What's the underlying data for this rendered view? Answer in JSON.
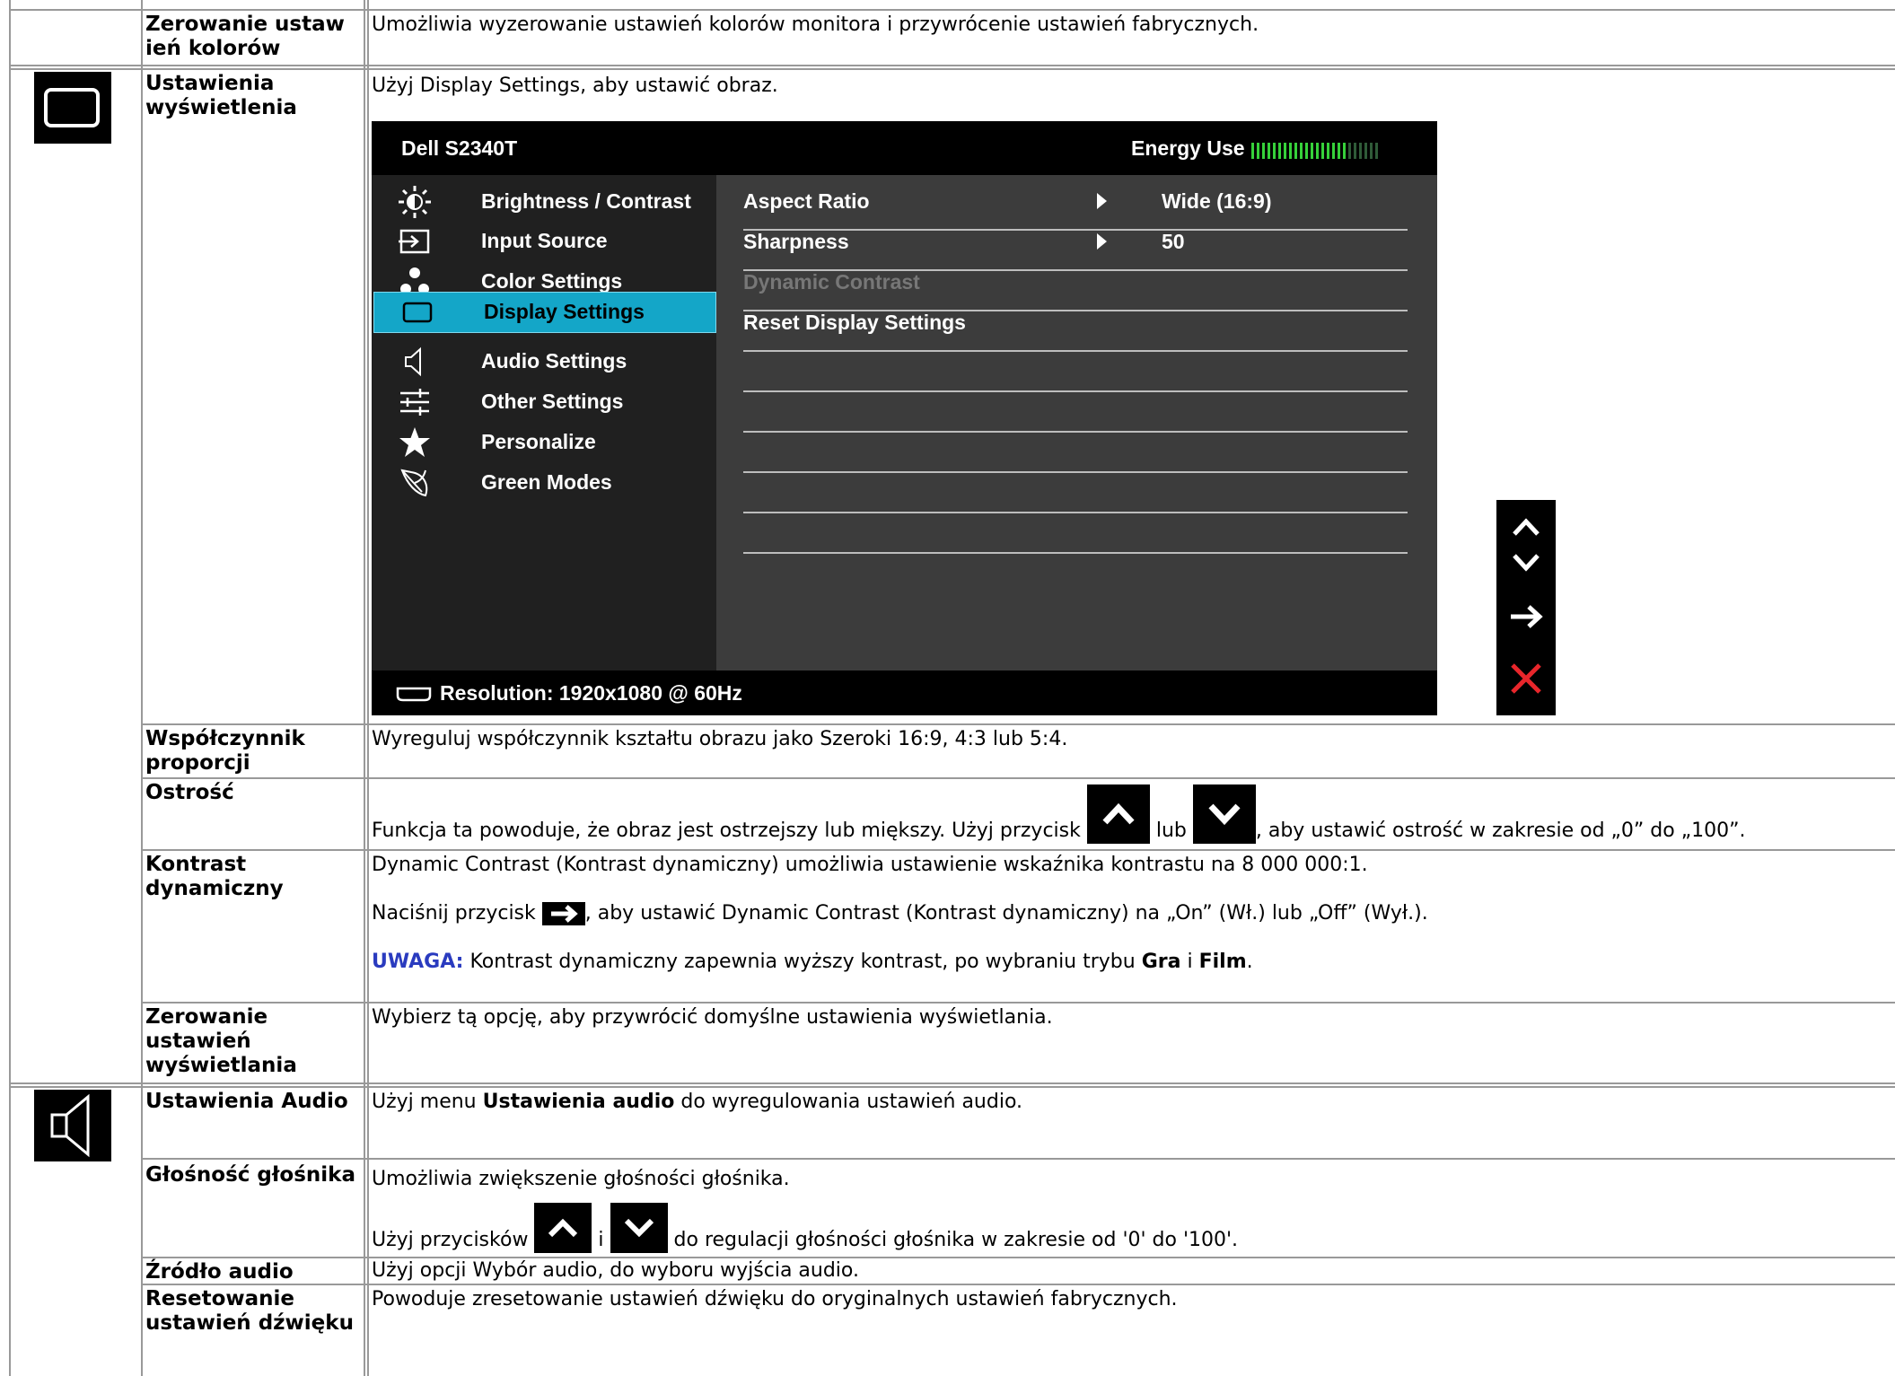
{
  "rows": [
    {
      "label": "Zerowanie ustaw\nień kolorów",
      "desc": "Umożliwia wyzerowanie ustawień kolorów monitora i przywrócenie ustawień fabrycznych."
    },
    {
      "label": "Ustawienia wyświetlenia",
      "desc": "Użyj Display Settings, aby ustawić obraz."
    },
    {
      "label": "Współczynnik proporcji",
      "desc": "Wyreguluj współczynnik kształtu obrazu jako Szeroki 16:9, 4:3 lub 5:4."
    },
    {
      "label": "Ostrość",
      "desc_a": "Funkcja ta powoduje, że obraz jest ostrzejszy lub miększy. Użyj przycisk ",
      "desc_b": " lub ",
      "desc_c": ", aby ustawić ostrość w zakresie od „0” do „100”."
    },
    {
      "label": "Kontrast dynamiczny",
      "desc1": "Dynamic Contrast (Kontrast dynamiczny) umożliwia ustawienie wskaźnika kontrastu na 8 000 000:1.",
      "desc2_a": "Naciśnij przycisk ",
      "desc2_b": ", aby ustawić Dynamic Contrast (Kontrast dynamiczny) na „On” (Wł.) lub „Off” (Wył.).",
      "note_key": "UWAGA:",
      "note_a": " Kontrast dynamiczny zapewnia wyższy kontrast, po wybraniu trybu ",
      "note_b": "Gra",
      "note_c": " i ",
      "note_d": "Film",
      "note_e": "."
    },
    {
      "label": "Zerowanie ustawień wyświetlania",
      "desc": "Wybierz tą opcję, aby przywrócić domyślne ustawienia wyświetlania."
    },
    {
      "label": "Ustawienia Audio",
      "desc_a": "Użyj menu ",
      "desc_b": "Ustawienia audio",
      "desc_c": " do wyregulowania ustawień audio."
    },
    {
      "label": "Głośność głośnika",
      "desc1": "Umożliwia zwiększenie głośności głośnika.",
      "desc2_a": "Użyj przycisków ",
      "desc2_b": " i ",
      "desc2_c": " do regulacji głośności głośnika w zakresie od '0' do '100'."
    },
    {
      "label": "Źródło audio",
      "desc": "Użyj opcji Wybór audio, do wyboru wyjścia audio."
    },
    {
      "label": "Resetowanie ustawień dźwięku",
      "desc": "Powoduje zresetowanie ustawień dźwięku do oryginalnych ustawień fabrycznych."
    }
  ],
  "osd": {
    "model": "Dell S2340T",
    "energy_label": "Energy Use",
    "energy_level": 0.75,
    "menu": [
      {
        "label": "Brightness / Contrast",
        "icon": "brightness-icon"
      },
      {
        "label": "Input Source",
        "icon": "input-source-icon"
      },
      {
        "label": "Color Settings",
        "icon": "color-settings-icon"
      },
      {
        "label": "Display Settings",
        "icon": "display-settings-icon",
        "selected": true
      },
      {
        "label": "Audio Settings",
        "icon": "speaker-icon"
      },
      {
        "label": "Other Settings",
        "icon": "other-settings-icon"
      },
      {
        "label": "Personalize",
        "icon": "star-icon"
      },
      {
        "label": "Green Modes",
        "icon": "leaf-icon"
      }
    ],
    "submenu": [
      {
        "label": "Aspect Ratio",
        "value": "Wide (16:9)",
        "arrow": true
      },
      {
        "label": "Sharpness",
        "value": "50",
        "arrow": true
      },
      {
        "label": "Dynamic Contrast",
        "value": "",
        "disabled": true
      },
      {
        "label": "Reset Display Settings",
        "value": ""
      }
    ],
    "resolution": "Resolution: 1920x1080 @ 60Hz"
  },
  "colors": {
    "accent": "#14a6c8",
    "energy_green": "#36d13a",
    "close_red": "#e8262b",
    "note_blue": "#2a3bbf"
  }
}
